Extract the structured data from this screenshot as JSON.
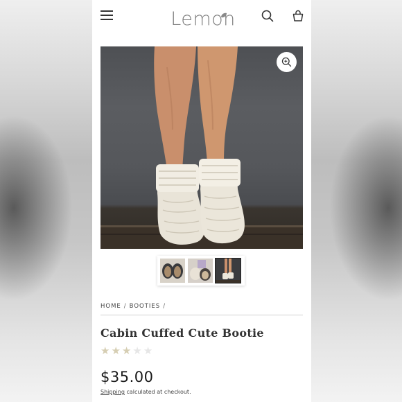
{
  "header": {
    "logo_text": "Lemon",
    "menu_icon": "hamburger-icon",
    "search_icon": "search-icon",
    "cart_icon": "shopping-bag-icon"
  },
  "product": {
    "zoom_icon": "zoom-in-icon",
    "thumbnails": [
      "slipper-pair-thumbnail",
      "slipper-gift-thumbnail",
      "bootie-legs-thumbnail"
    ],
    "breadcrumb": [
      "HOME",
      "BOOTIES"
    ],
    "breadcrumb_separator": "/",
    "title": "Cabin Cuffed Cute Bootie",
    "rating": 3,
    "rating_max": 5,
    "price": "$35.00",
    "shipping_link": "Shipping",
    "shipping_text": " calculated at checkout."
  },
  "colors": {
    "star_filled": "#d6ceb3",
    "star_empty": "#e6e6e6",
    "logo": "#7d7d7d",
    "leaf": "#8a8a8a"
  }
}
